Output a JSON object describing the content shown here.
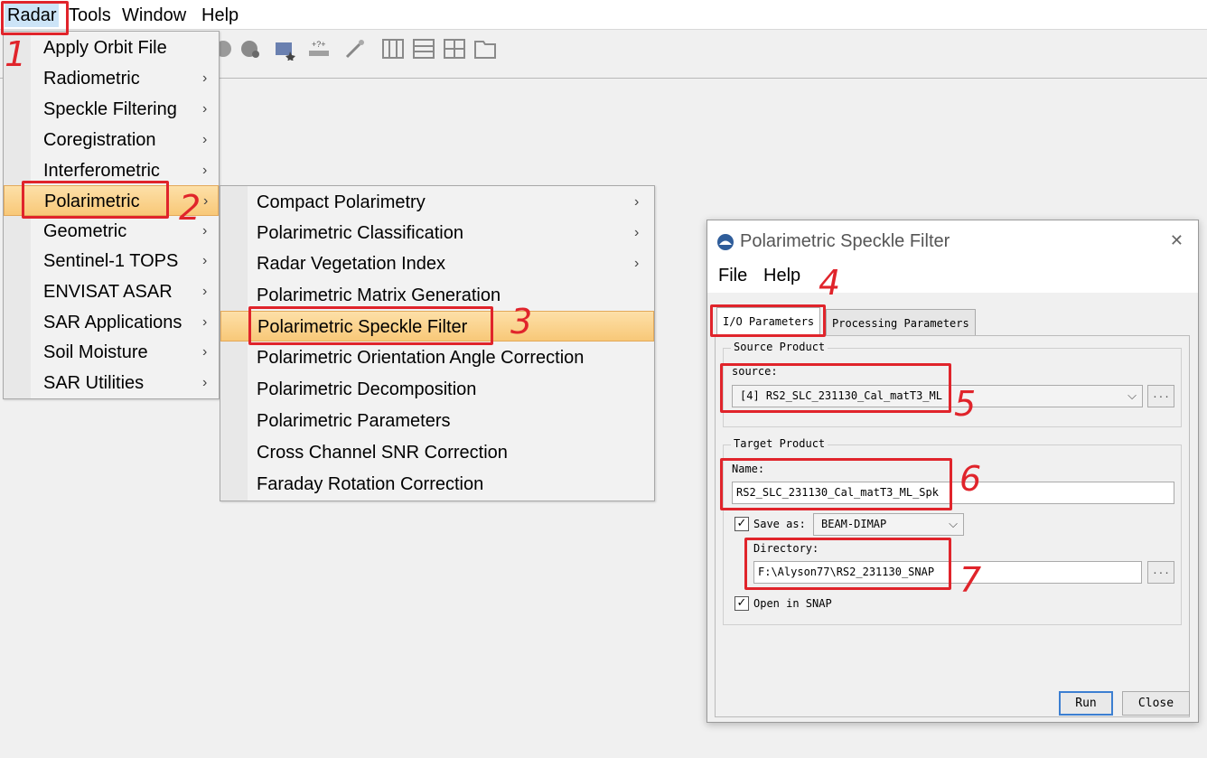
{
  "menubar": {
    "items": [
      "Radar",
      "Tools",
      "Window",
      "Help"
    ]
  },
  "radar_menu": {
    "items": [
      {
        "label": "Apply Orbit File",
        "submenu": false
      },
      {
        "label": "Radiometric",
        "submenu": true
      },
      {
        "label": "Speckle Filtering",
        "submenu": true
      },
      {
        "label": "Coregistration",
        "submenu": true
      },
      {
        "label": "Interferometric",
        "submenu": true
      },
      {
        "label": "Polarimetric",
        "submenu": true,
        "highlighted": true
      },
      {
        "label": "Geometric",
        "submenu": true
      },
      {
        "label": "Sentinel-1 TOPS",
        "submenu": true
      },
      {
        "label": "ENVISAT ASAR",
        "submenu": true
      },
      {
        "label": "SAR Applications",
        "submenu": true
      },
      {
        "label": "Soil Moisture",
        "submenu": true
      },
      {
        "label": "SAR Utilities",
        "submenu": true
      }
    ]
  },
  "polarimetric_menu": {
    "items": [
      {
        "label": "Compact Polarimetry",
        "submenu": true
      },
      {
        "label": "Polarimetric Classification",
        "submenu": true
      },
      {
        "label": "Radar Vegetation Index",
        "submenu": true
      },
      {
        "label": "Polarimetric Matrix Generation",
        "submenu": false
      },
      {
        "label": "Polarimetric Speckle Filter",
        "submenu": false,
        "highlighted": true
      },
      {
        "label": "Polarimetric Orientation Angle Correction",
        "submenu": false
      },
      {
        "label": "Polarimetric Decomposition",
        "submenu": false
      },
      {
        "label": "Polarimetric Parameters",
        "submenu": false
      },
      {
        "label": "Cross Channel SNR Correction",
        "submenu": false
      },
      {
        "label": "Faraday Rotation Correction",
        "submenu": false
      }
    ]
  },
  "submenu_arrow": "›",
  "dialog": {
    "title": "Polarimetric Speckle Filter",
    "close_glyph": "✕",
    "menu": [
      "File",
      "Help"
    ],
    "tabs": [
      "I/O Parameters",
      "Processing Parameters"
    ],
    "source_group": {
      "title": "Source Product",
      "label": "source:",
      "value": "[4] RS2_SLC_231130_Cal_matT3_ML"
    },
    "target_group": {
      "title": "Target Product",
      "name_label": "Name:",
      "name_value": "RS2_SLC_231130_Cal_matT3_ML_Spk",
      "save_as_label": "Save as:",
      "save_as_checked": true,
      "format_value": "BEAM-DIMAP",
      "directory_label": "Directory:",
      "directory_value": "F:\\Alyson77\\RS2_231130_SNAP",
      "open_in_snap_label": "Open in SNAP",
      "open_in_snap_checked": true
    },
    "browse_label": "...",
    "run_label": "Run",
    "close_label": "Close",
    "check_glyph": "✓",
    "chevron_glyph": "⌵"
  },
  "annotations": [
    "1",
    "2",
    "3",
    "4",
    "5",
    "6",
    "7"
  ],
  "colors": {
    "highlight": "#f8c878",
    "annotation_red": "#e0242b",
    "menubar_active": "#cce4f7"
  }
}
